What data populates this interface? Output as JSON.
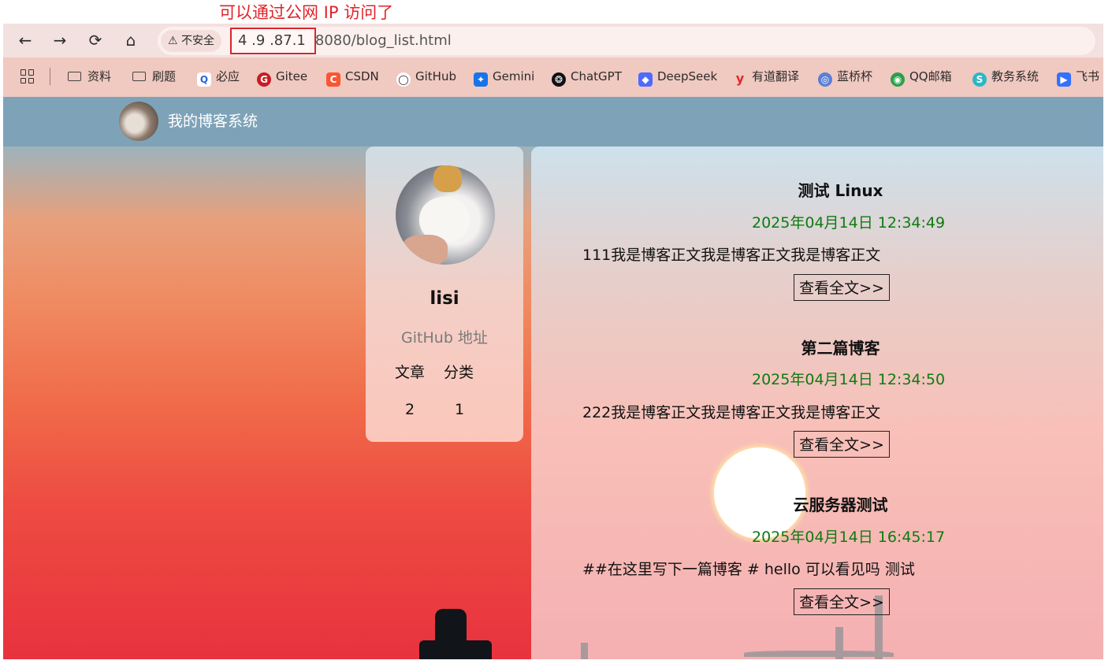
{
  "annotation": "可以通过公网 IP 访问了",
  "browser": {
    "nav": {
      "back_icon": "←",
      "forward_icon": "→",
      "reload_icon": "⟳",
      "home_icon": "⌂"
    },
    "security": {
      "icon": "⚠",
      "label": "不安全"
    },
    "url": {
      "highlighted": "4 .9 .87.1",
      "rest": "8080/blog_list.html"
    },
    "bookmarks": [
      {
        "label": "资料"
      },
      {
        "label": "刷题"
      },
      {
        "label": "必应",
        "icon": "Q"
      },
      {
        "label": "Gitee",
        "icon": "G"
      },
      {
        "label": "CSDN",
        "icon": "C"
      },
      {
        "label": "GitHub",
        "icon": "◯"
      },
      {
        "label": "Gemini",
        "icon": "✦"
      },
      {
        "label": "ChatGPT",
        "icon": "❂"
      },
      {
        "label": "DeepSeek",
        "icon": "◆"
      },
      {
        "label": "有道翻译",
        "icon": "y"
      },
      {
        "label": "蓝桥杯",
        "icon": "◎"
      },
      {
        "label": "QQ邮箱",
        "icon": "◉"
      },
      {
        "label": "教务系统",
        "icon": "S"
      },
      {
        "label": "飞书",
        "icon": "▶"
      }
    ]
  },
  "site": {
    "title": "我的博客系统"
  },
  "profile": {
    "username": "lisi",
    "github_label": "GitHub 地址",
    "articles_label": "文章",
    "categories_label": "分类",
    "articles_count": "2",
    "categories_count": "1"
  },
  "posts": [
    {
      "title": "测试 Linux",
      "date": "2025年04月14日 12:34:49",
      "excerpt": "111我是博客正文我是博客正文我是博客正文",
      "read_more": "查看全文>>"
    },
    {
      "title": "第二篇博客",
      "date": "2025年04月14日 12:34:50",
      "excerpt": "222我是博客正文我是博客正文我是博客正文",
      "read_more": "查看全文>>"
    },
    {
      "title": "云服务器测试",
      "date": "2025年04月14日 16:45:17",
      "excerpt": "##在这里写下一篇博客 # hello 可以看见吗 测试",
      "read_more": "查看全文>>"
    }
  ]
}
